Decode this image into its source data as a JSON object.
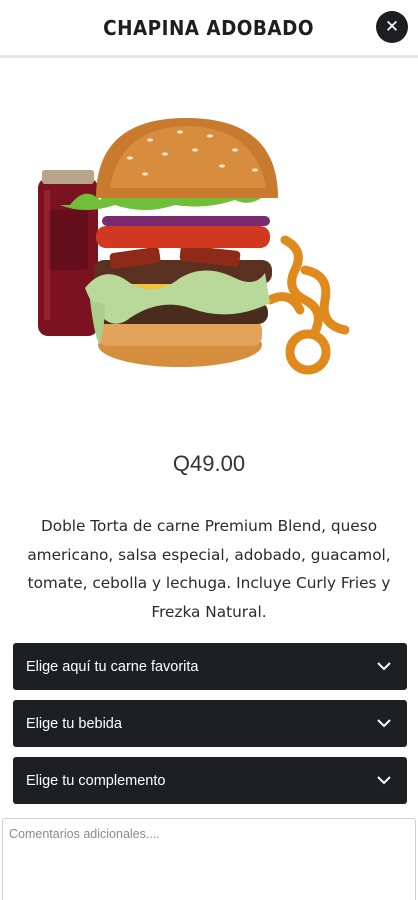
{
  "header": {
    "title": "CHAPINA ADOBADO",
    "close_icon": "close-icon"
  },
  "product": {
    "image_icon": "burger-with-curly-fries-and-drink",
    "price": "Q49.00",
    "description": "Doble Torta de carne Premium Blend, queso americano, salsa especial, adobado, guacamol, tomate, cebolla y lechuga. Incluye Curly Fries y Frezka Natural."
  },
  "options": [
    {
      "label": "Elige aquí tu carne favorita",
      "icon": "chevron-down-icon"
    },
    {
      "label": "Elige tu bebida",
      "icon": "chevron-down-icon"
    },
    {
      "label": "Elige tu complemento",
      "icon": "chevron-down-icon"
    }
  ],
  "comments": {
    "placeholder": "Comentarios adicionales...."
  },
  "colors": {
    "dark": "#1e1f23",
    "divider": "#e6e6e6"
  }
}
